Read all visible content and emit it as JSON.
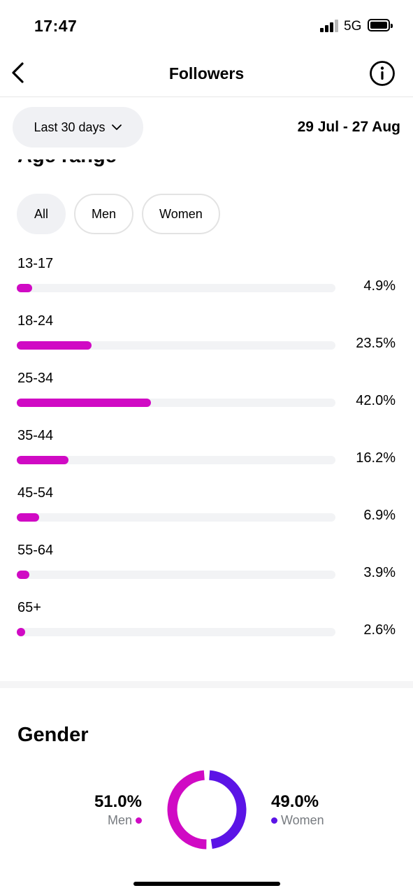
{
  "status_bar": {
    "time": "17:47",
    "network": "5G"
  },
  "nav": {
    "title": "Followers"
  },
  "filter": {
    "range_label": "Last 30 days",
    "date_range": "29 Jul - 27 Aug"
  },
  "age": {
    "heading": "Age range",
    "tabs": [
      {
        "label": "All",
        "selected": true
      },
      {
        "label": "Men",
        "selected": false
      },
      {
        "label": "Women",
        "selected": false
      }
    ],
    "rows": [
      {
        "label": "13-17",
        "value": 4.9,
        "display": "4.9%"
      },
      {
        "label": "18-24",
        "value": 23.5,
        "display": "23.5%"
      },
      {
        "label": "25-34",
        "value": 42.0,
        "display": "42.0%"
      },
      {
        "label": "35-44",
        "value": 16.2,
        "display": "16.2%"
      },
      {
        "label": "45-54",
        "value": 6.9,
        "display": "6.9%"
      },
      {
        "label": "55-64",
        "value": 3.9,
        "display": "3.9%"
      },
      {
        "label": "65+",
        "value": 2.6,
        "display": "2.6%"
      }
    ]
  },
  "gender": {
    "title": "Gender",
    "men": {
      "value": 51.0,
      "display": "51.0%",
      "label": "Men",
      "color": "#d00ac4"
    },
    "women": {
      "value": 49.0,
      "display": "49.0%",
      "label": "Women",
      "color": "#5b14e6"
    }
  },
  "colors": {
    "bar_fill": "#d00ac4",
    "track": "#f2f3f5"
  }
}
